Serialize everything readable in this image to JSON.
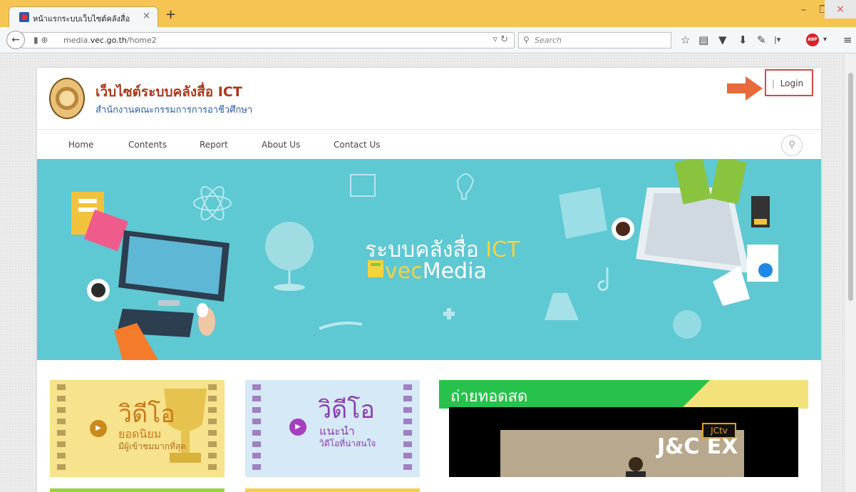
{
  "browser": {
    "tab_title": "หน้าแรกระบบเว็บไซต์คลังสื่อ",
    "tab_close": "×",
    "new_tab": "+",
    "url_host_prefix": "media.",
    "url_host": "vec.go.th",
    "url_path": "/home2",
    "search_placeholder": "Search",
    "win_minimize": "–",
    "win_restore": "❐",
    "win_close": "×"
  },
  "site": {
    "title": "เว็บไซต์ระบบคลังสื่อ ICT",
    "subtitle": "สำนักงานคณะกรรมการการอาชีวศึกษา",
    "login_label": "Login",
    "login_separator": "|",
    "nav": [
      "Home",
      "Contents",
      "Report",
      "About Us",
      "Contact Us"
    ]
  },
  "banner": {
    "line1_main": "ระบบคลังสื่อ ",
    "line1_accent": "ICT",
    "line2_accent": "vec",
    "line2_main": "Media"
  },
  "cards": {
    "popular": {
      "big": "วิดีโอ",
      "mid": "ยอดนิยม",
      "small": "มีผู้เข้าชมมากที่สุด"
    },
    "recommended": {
      "big": "วิดีโอ",
      "mid": "แนะนำ",
      "small": "วิดีโอที่น่าสนใจ"
    },
    "live": {
      "title": "ถ่ายทอดสด",
      "video_text": "J&C EX",
      "channel_logo": "JCtv"
    }
  },
  "colors": {
    "tabbar": "#f6c453",
    "banner": "#5ec8d3",
    "title_red": "#a83a1f",
    "subtitle_blue": "#2b5ea8",
    "login_border": "#d24a4a",
    "arrow": "#e86a3a",
    "live_green": "#27c24c"
  },
  "icons": [
    "back-arrow-icon",
    "search-icon",
    "bookmark-star-icon",
    "reading-list-icon",
    "pocket-icon",
    "download-icon",
    "extension-icon",
    "adblock-icon",
    "hamburger-menu-icon",
    "play-icon"
  ]
}
